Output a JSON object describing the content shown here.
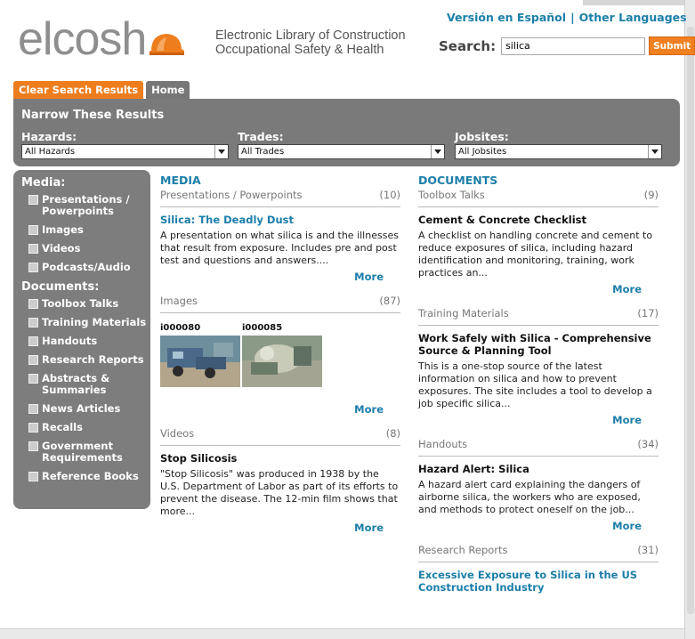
{
  "header": {
    "logo_text": "elcosh",
    "tagline_line1": "Electronic Library of Construction",
    "tagline_line2": "Occupational Safety & Health",
    "lang_spanish": "Versión en Español",
    "lang_separator": "|",
    "lang_other": "Other Languages",
    "search_label": "Search:",
    "search_value": "silica",
    "search_button": "Submit"
  },
  "tabs": {
    "clear": "Clear Search Results",
    "home": "Home"
  },
  "filters": {
    "title": "Narrow These Results",
    "hazards_label": "Hazards:",
    "hazards_value": "All Hazards",
    "trades_label": "Trades:",
    "trades_value": "All Trades",
    "jobsites_label": "Jobsites:",
    "jobsites_value": "All Jobsites"
  },
  "sidebar": {
    "media_title": "Media:",
    "media_items": [
      "Presentations / Powerpoints",
      "Images",
      "Videos",
      "Podcasts/Audio"
    ],
    "documents_title": "Documents:",
    "document_items": [
      "Toolbox Talks",
      "Training Materials",
      "Handouts",
      "Research Reports",
      "Abstracts & Summaries",
      "News Articles",
      "Recalls",
      "Government Requirements",
      "Reference Books"
    ]
  },
  "media": {
    "heading": "MEDIA",
    "presentations": {
      "label": "Presentations / Powerpoints",
      "count": "(10)",
      "title": "Silica: The Deadly Dust",
      "desc": "A presentation on what silica is and the illnesses that result from exposure. Includes pre and post test and questions and answers....",
      "more": "More"
    },
    "images": {
      "label": "Images",
      "count": "(87)",
      "thumb1_id": "i000080",
      "thumb2_id": "i000085",
      "more": "More"
    },
    "videos": {
      "label": "Videos",
      "count": "(8)",
      "title": "Stop Silicosis",
      "desc": "\"Stop Silicosis\" was produced in 1938 by the U.S. Department of Labor as part of its efforts to prevent the disease. The 12-min film shows that more...",
      "more": "More"
    }
  },
  "documents": {
    "heading": "DOCUMENTS",
    "toolbox": {
      "label": "Toolbox Talks",
      "count": "(9)",
      "title": "Cement & Concrete Checklist",
      "desc": "A checklist on handling concrete and cement to reduce exposures of silica, including hazard identification and monitoring, training, work practices an...",
      "more": "More"
    },
    "training": {
      "label": "Training Materials",
      "count": "(17)",
      "title": "Work Safely with Silica - Comprehensive Source & Planning Tool",
      "desc": "This is a one-stop source of the latest information on silica and how to prevent exposures. The site includes a tool to develop a job specific silica...",
      "more": "More"
    },
    "handouts": {
      "label": "Handouts",
      "count": "(34)",
      "title": "Hazard Alert: Silica",
      "desc": "A hazard alert card explaining the dangers of airborne silica, the workers who are exposed, and methods to protect oneself on the job...",
      "more": "More"
    },
    "research": {
      "label": "Research Reports",
      "count": "(31)",
      "title": "Excessive Exposure to Silica in the US Construction Industry"
    }
  },
  "colors": {
    "accent_blue": "#1b7ea9",
    "accent_orange": "#ee7d1e",
    "panel_gray": "#7a7a7a"
  }
}
